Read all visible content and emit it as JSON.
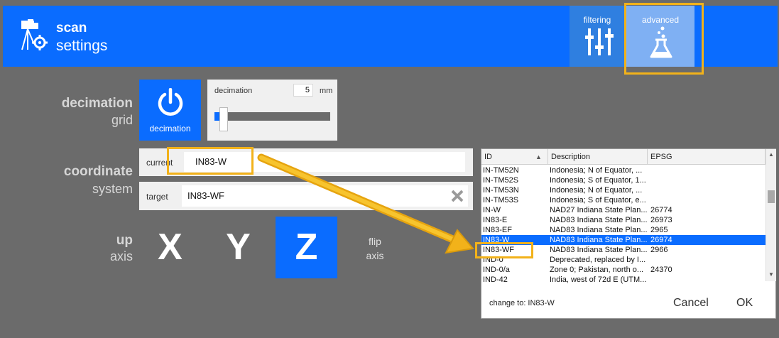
{
  "header": {
    "title_bold": "scan",
    "title_regular": "settings",
    "tabs": [
      {
        "label": "filtering",
        "icon": "sliders-icon"
      },
      {
        "label": "advanced",
        "icon": "flask-icon"
      }
    ]
  },
  "decimation": {
    "heading_bold": "decimation",
    "heading_regular": "grid",
    "button_label": "decimation",
    "panel_label": "decimation",
    "value": "5",
    "unit": "mm",
    "slider_level": 0.04
  },
  "coordinate": {
    "heading_bold": "coordinate",
    "heading_regular": "system",
    "current_label": "current",
    "current_value": "IN83-W",
    "target_label": "target",
    "target_value": "IN83-WF"
  },
  "axis": {
    "heading_bold": "up",
    "heading_regular": "axis",
    "buttons": [
      "X",
      "Y",
      "Z"
    ],
    "selected": "Z",
    "flip_line1": "flip",
    "flip_line2": "axis"
  },
  "dialog": {
    "columns": [
      "ID",
      "Description",
      "EPSG"
    ],
    "rows": [
      {
        "id": "IN-TM52N",
        "desc": "Indonesia; N of Equator, ...",
        "epsg": ""
      },
      {
        "id": "IN-TM52S",
        "desc": "Indonesia; S of Equator, 1...",
        "epsg": ""
      },
      {
        "id": "IN-TM53N",
        "desc": "Indonesia; N of Equator, ...",
        "epsg": ""
      },
      {
        "id": "IN-TM53S",
        "desc": "Indonesia; S of Equator, e...",
        "epsg": ""
      },
      {
        "id": "IN-W",
        "desc": "NAD27 Indiana State Plan...",
        "epsg": "26774"
      },
      {
        "id": "IN83-E",
        "desc": "NAD83 Indiana State Plan...",
        "epsg": "26973"
      },
      {
        "id": "IN83-EF",
        "desc": "NAD83 Indiana State Plan...",
        "epsg": "2965"
      },
      {
        "id": "IN83-W",
        "desc": "NAD83 Indiana State Plan...",
        "epsg": "26974"
      },
      {
        "id": "IN83-WF",
        "desc": "NAD83 Indiana State Plan...",
        "epsg": "2966"
      },
      {
        "id": "IND-0",
        "desc": "Deprecated, replaced by I...",
        "epsg": ""
      },
      {
        "id": "IND-0/a",
        "desc": "Zone 0; Pakistan, north o...",
        "epsg": "24370"
      },
      {
        "id": "IND-42",
        "desc": "India, west of 72d E (UTM...",
        "epsg": ""
      }
    ],
    "selected_row": 7,
    "change_to_text": "change to: IN83-W",
    "cancel_label": "Cancel",
    "ok_label": "OK"
  },
  "colors": {
    "accent": "#0a6cff",
    "highlight": "#f2b21a",
    "background": "#6b6b6b"
  }
}
